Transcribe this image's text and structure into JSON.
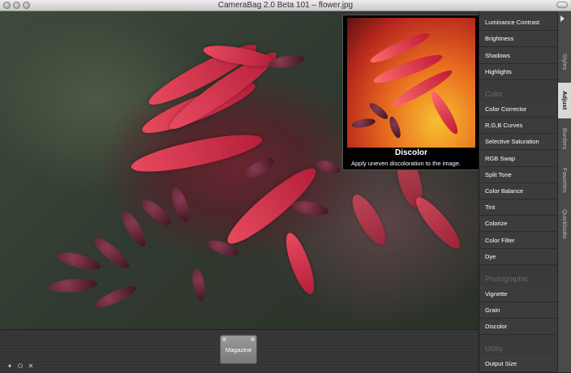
{
  "window": {
    "title": "CameraBag 2.0 Beta 101 – flower.jpg"
  },
  "preview": {
    "title": "Discolor",
    "description": "Apply uneven discoloration to the image."
  },
  "sidebar": {
    "items_top": [
      "Luminance Contrast",
      "Brightness",
      "Shadows",
      "Highlights"
    ],
    "section_color": "Color",
    "items_color": [
      "Color Corrector",
      "R,G,B Curves",
      "Selective Saturation",
      "RGB Swap",
      "Split Tone",
      "Color Balance",
      "Tint",
      "Colorize",
      "Color Filter",
      "Dye"
    ],
    "section_photographic": "Photographic",
    "items_photographic": [
      "Vignette",
      "Grain",
      "Discolor"
    ],
    "section_utility": "Utility",
    "items_utility": [
      "Output Size"
    ]
  },
  "tabs": {
    "styles": "Styles",
    "adjust": "Adjust",
    "borders": "Borders",
    "favorites": "Favorites",
    "quicklooks": "Quicklooks"
  },
  "bottom": {
    "active_style": "Magazine"
  },
  "icons": {
    "down": "▾",
    "power": "⏻",
    "close": "✕"
  }
}
